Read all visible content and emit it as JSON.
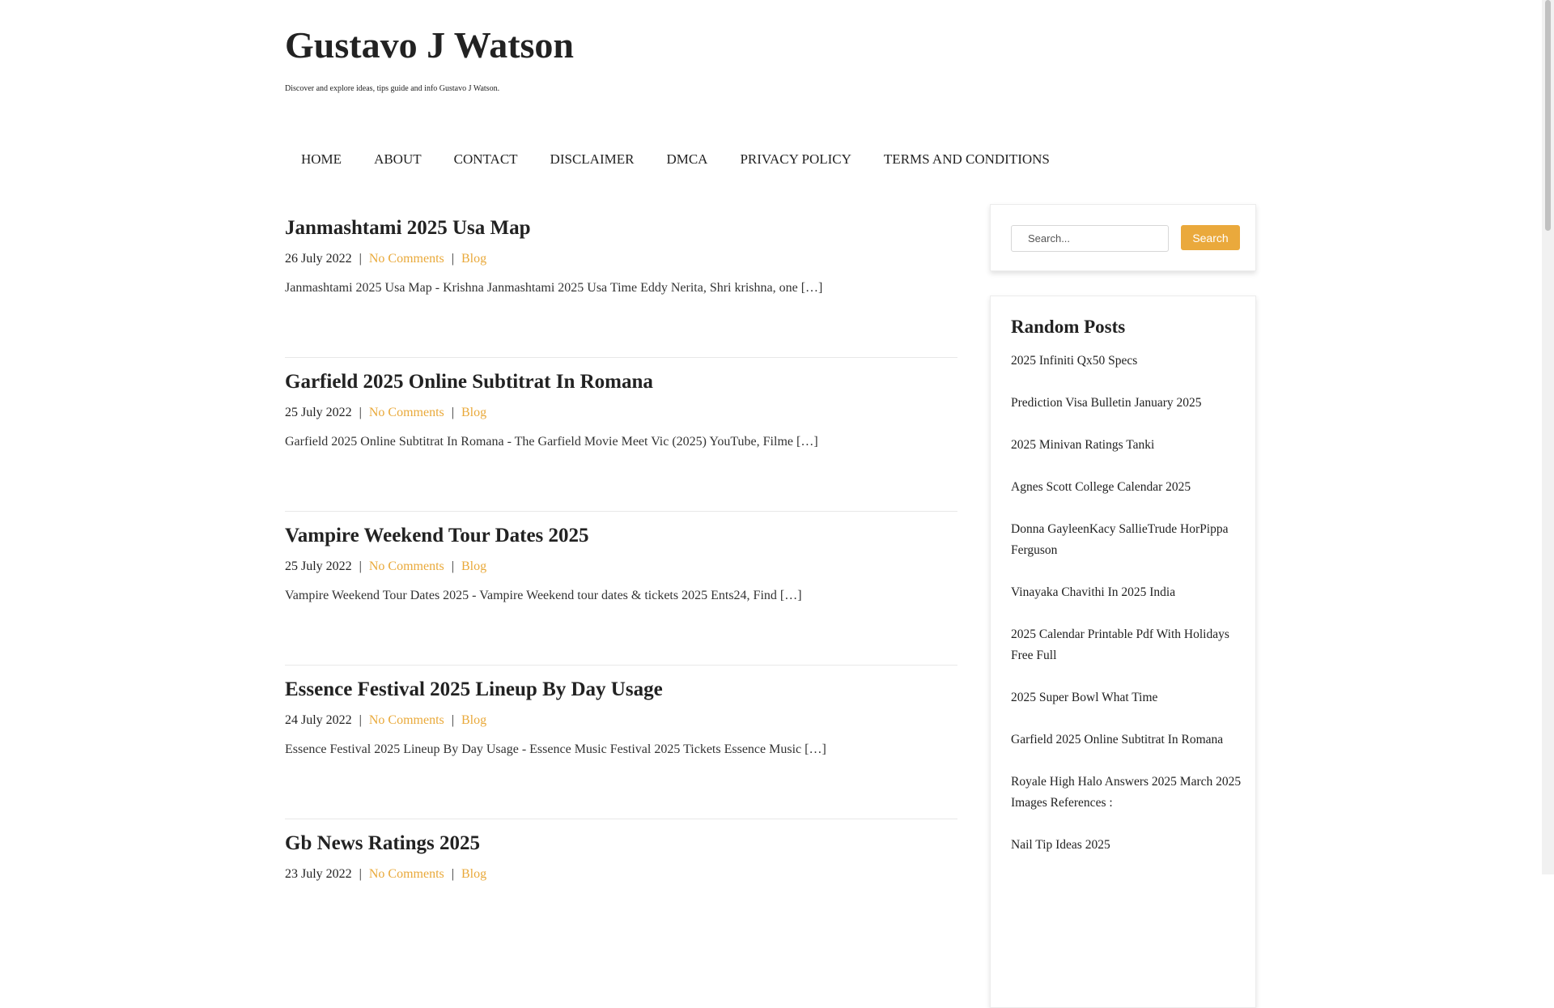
{
  "site": {
    "title": "Gustavo J Watson",
    "description": "Discover and explore ideas, tips guide and info Gustavo J Watson."
  },
  "nav": {
    "items": [
      "HOME",
      "ABOUT",
      "CONTACT",
      "DISCLAIMER",
      "DMCA",
      "PRIVACY POLICY",
      "TERMS AND CONDITIONS"
    ]
  },
  "posts": [
    {
      "title": "Janmashtami 2025 Usa Map",
      "date": "26 July 2022",
      "comments": "No Comments",
      "category": "Blog",
      "excerpt": "Janmashtami 2025 Usa Map - Krishna Janmashtami 2025 Usa Time Eddy Nerita, Shri krishna, one […]"
    },
    {
      "title": "Garfield 2025 Online Subtitrat In Romana",
      "date": "25 July 2022",
      "comments": "No Comments",
      "category": "Blog",
      "excerpt": "Garfield 2025 Online Subtitrat In Romana - The Garfield Movie Meet Vic (2025) YouTube, Filme […]"
    },
    {
      "title": "Vampire Weekend Tour Dates 2025",
      "date": "25 July 2022",
      "comments": "No Comments",
      "category": "Blog",
      "excerpt": "Vampire Weekend Tour Dates 2025 - Vampire Weekend tour dates & tickets 2025 Ents24, Find […]"
    },
    {
      "title": "Essence Festival 2025 Lineup By Day Usage",
      "date": "24 July 2022",
      "comments": "No Comments",
      "category": "Blog",
      "excerpt": "Essence Festival 2025 Lineup By Day Usage - Essence Music Festival 2025 Tickets Essence Music […]"
    },
    {
      "title": "Gb News Ratings 2025",
      "date": "23 July 2022",
      "comments": "No Comments",
      "category": "Blog",
      "excerpt": ""
    }
  ],
  "meta_separator": "|",
  "search": {
    "placeholder": "Search...",
    "button_label": "Search"
  },
  "random_posts": {
    "title": "Random Posts",
    "items": [
      "2025 Infiniti Qx50 Specs",
      "Prediction Visa Bulletin January 2025",
      "2025 Minivan Ratings Tanki",
      "Agnes Scott College Calendar 2025",
      "Donna GayleenKacy SallieTrude HorPippa Ferguson",
      "Vinayaka Chavithi In 2025 India",
      "2025 Calendar Printable Pdf With Holidays Free Full",
      "2025 Super Bowl What Time",
      "Garfield 2025 Online Subtitrat In Romana",
      "Royale High Halo Answers 2025 March 2025 Images References :",
      "Nail Tip Ideas 2025"
    ]
  },
  "colors": {
    "accent": "#e9a93a",
    "text": "#222222",
    "divider": "#e8e8e8"
  }
}
